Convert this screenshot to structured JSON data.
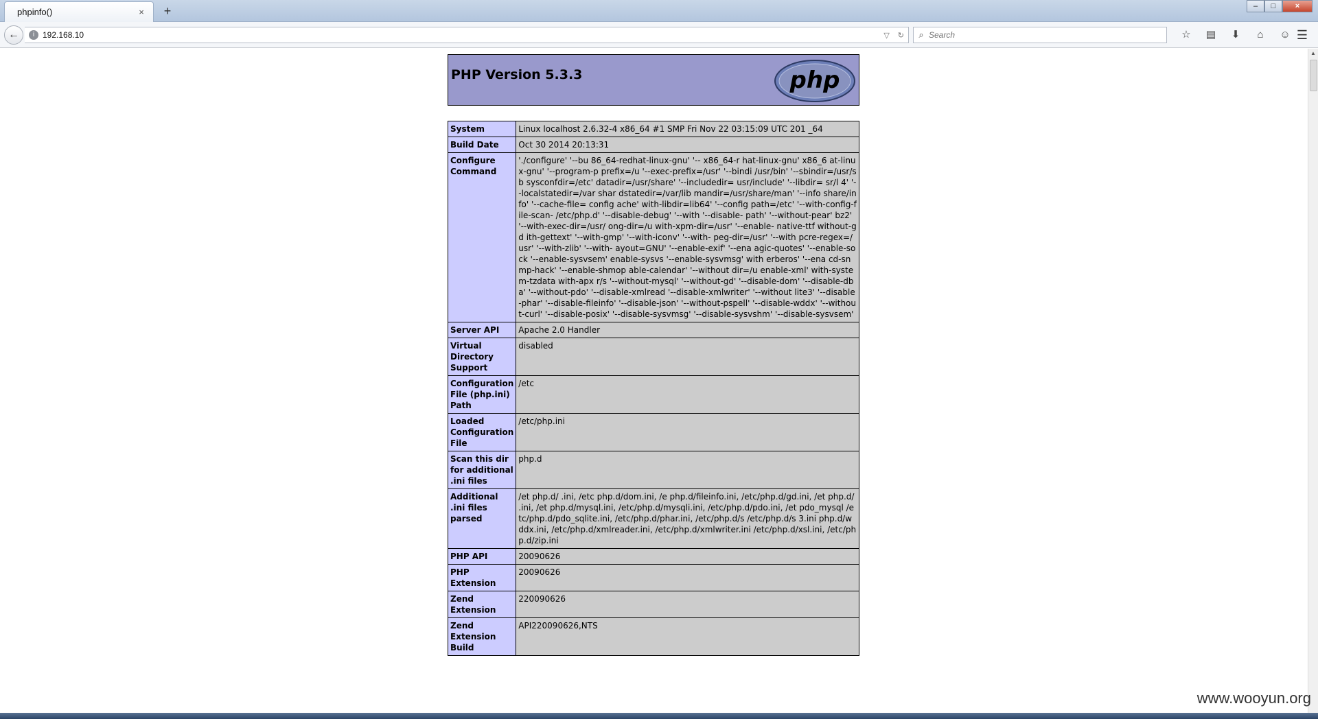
{
  "browser": {
    "tab_title": "phpinfo()",
    "tab_close": "×",
    "new_tab": "+",
    "url": "192.168.10",
    "search_placeholder": "Search",
    "icons": [
      "star-icon",
      "bookmarks-icon",
      "download-icon",
      "home-icon",
      "chat-icon"
    ]
  },
  "page": {
    "version_title": "PHP Version 5.3.3",
    "logo_text": "php",
    "rows": [
      {
        "key": "System",
        "value": "Linux localhost 2.6.32-4 x86_64 #1 SMP Fri Nov 22 03:15:09 UTC 201 _64"
      },
      {
        "key": "Build Date",
        "value": "Oct 30 2014 20:13:31"
      },
      {
        "key": "Configure Command",
        "value": "'./configure' '--bu 86_64-redhat-linux-gnu' '-- x86_64-r hat-linux-gnu' x86_6 at-linux-gnu' '--program-p prefix=/u '--exec-prefix=/usr' '--bindi /usr/bin' '--sbindir=/usr/sb sysconfdir=/etc' datadir=/usr/share' '--includedir= usr/include' '--libdir= sr/l 4' '--localstatedir=/var shar dstatedir=/var/lib mandir=/usr/share/man' '--info share/info' '--cache-file= config ache' with-libdir=lib64' '--config path=/etc' '--with-config-file-scan- /etc/php.d' '--disable-debug' '--with '--disable- path' '--without-pear' bz2' '--with-exec-dir=/usr/ ong-dir=/u with-xpm-dir=/usr' '--enable- native-ttf without-gd ith-gettext' '--with-gmp' '--with-iconv' '--with- peg-dir=/usr' '--with pcre-regex=/usr' '--with-zlib' '--with- ayout=GNU' '--enable-exif' '--ena agic-quotes' '--enable-sock '--enable-sysvsem' enable-sysvs '--enable-sysvmsg' with erberos' '--ena cd-snmp-hack' '--enable-shmop able-calendar' '--without dir=/u enable-xml' with-system-tzdata with-apx r/s '--without-mysql' '--without-gd' '--disable-dom' '--disable-dba' '--without-pdo' '--disable-xmlread '--disable-xmlwriter' '--without lite3' '--disable-phar' '--disable-fileinfo' '--disable-json' '--without-pspell' '--disable-wddx' '--without-curl' '--disable-posix' '--disable-sysvmsg' '--disable-sysvshm' '--disable-sysvsem'"
      },
      {
        "key": "Server API",
        "value": "Apache 2.0 Handler"
      },
      {
        "key": "Virtual Directory Support",
        "value": "disabled"
      },
      {
        "key": "Configuration File (php.ini) Path",
        "value": "/etc"
      },
      {
        "key": "Loaded Configuration File",
        "value": "/etc/php.ini"
      },
      {
        "key": "Scan this dir for additional .ini files",
        "value": "php.d"
      },
      {
        "key": "Additional .ini files parsed",
        "value": "/et php.d/ .ini, /etc php.d/dom.ini, /e php.d/fileinfo.ini, /etc/php.d/gd.ini, /et php.d/ .ini, /et php.d/mysql.ini, /etc/php.d/mysqli.ini, /etc/php.d/pdo.ini, /et pdo_mysql /etc/php.d/pdo_sqlite.ini, /etc/php.d/phar.ini, /etc/php.d/s /etc/php.d/s 3.ini php.d/wddx.ini, /etc/php.d/xmlreader.ini, /etc/php.d/xmlwriter.ini /etc/php.d/xsl.ini, /etc/php.d/zip.ini"
      },
      {
        "key": "PHP API",
        "value": "20090626"
      },
      {
        "key": "PHP Extension",
        "value": "20090626"
      },
      {
        "key": "Zend Extension",
        "value": "220090626"
      },
      {
        "key": "Zend Extension Build",
        "value": "API220090626,NTS"
      }
    ]
  },
  "watermark": "www.wooyun.org"
}
